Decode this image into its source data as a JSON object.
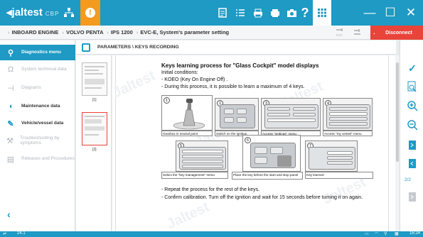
{
  "topbar": {
    "logo": "jaltest",
    "logo_sub": "CBP",
    "icons": [
      "hub-icon",
      "warning-icon",
      "document-icon",
      "list-icon",
      "printer-icon",
      "printer-alt-icon",
      "camera-icon",
      "help-icon",
      "grid-icon",
      "minimize-icon",
      "maximize-icon",
      "close-icon"
    ],
    "help_glyph": "?",
    "warning_glyph": "!",
    "minimize_glyph": "—",
    "maximize_glyph": "☐",
    "close_glyph": "✕"
  },
  "breadcrumb": {
    "items": [
      "INBOARD ENGINE",
      "VOLVO PENTA",
      "IPS 1200",
      "EVC-E, System's parameter setting"
    ],
    "disconnect_label": "Disconnect"
  },
  "sidebar": {
    "items": [
      {
        "label": "Diagnostics menu",
        "icon": "diagnostics-icon",
        "state": "active"
      },
      {
        "label": "System technical data",
        "icon": "ohm-icon",
        "state": "dim"
      },
      {
        "label": "Diagrams",
        "icon": "diagram-icon",
        "state": "dim"
      },
      {
        "label": "Maintenance data",
        "icon": "oil-can-icon",
        "state": "bold"
      },
      {
        "label": "Vehicle/vessel data",
        "icon": "wrench-icon",
        "state": "bold"
      },
      {
        "label": "Troubleshooting by symptoms",
        "icon": "troubleshoot-icon",
        "state": "dim"
      },
      {
        "label": "Releases and Procedures",
        "icon": "document-icon",
        "state": "dim"
      }
    ]
  },
  "main": {
    "header_title": "PARAMETERS \\ KEYS RECORDING",
    "thumb_numbers": [
      "[1]",
      "[2]"
    ]
  },
  "document": {
    "title": "Keys learning process for \"Glass Cockpit\" model displays",
    "lines": [
      "Initial conditions:",
      "- KOEO (Key On Engine Off) .",
      "- During this process, it is possible to learn a maximum of 4 keys."
    ],
    "steps_row1": [
      {
        "num": "1",
        "caption": "Gearbox in neutral point"
      },
      {
        "num": "2",
        "caption": "Switch on the ignition"
      },
      {
        "num": "3",
        "caption": "Access \"settings\" menu"
      },
      {
        "num": "4",
        "caption": "Access \"my vessel\" menu"
      }
    ],
    "steps_row2": [
      {
        "num": "5",
        "caption": "Select the \"key management\" menu"
      },
      {
        "num": "6",
        "caption": "Place the key before the start and stop panel"
      },
      {
        "num": "7",
        "caption": "Key learned"
      }
    ],
    "footer_lines": [
      "- Repeat the process for the rest of the keys.",
      "- Confirm calibration. Turn off the ignition and wait for 15 seconds before turning it on again."
    ],
    "watermark": "Jaltest"
  },
  "right_toolbar": {
    "page_indicator": "2/2"
  },
  "status": {
    "version": "24.1",
    "time": "16:24"
  }
}
